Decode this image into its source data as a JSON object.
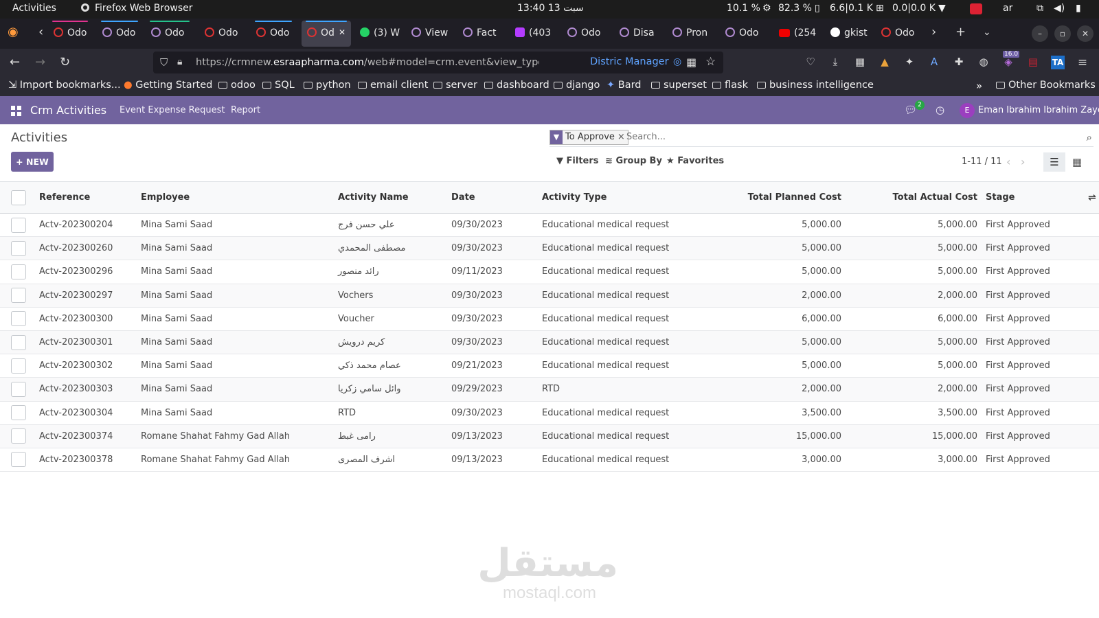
{
  "system_bar": {
    "activities": "Activities",
    "app": "Firefox Web Browser",
    "clock": "13:40  سبت 13",
    "cpu": "10.1 %",
    "mem": "82.3 %",
    "disk": "6.6|0.1 K",
    "net": "0.0|0.0 K",
    "lang": "ar"
  },
  "tabs": [
    {
      "label": "Odo",
      "icon": "odoo-red-icon",
      "accent": "#e0338f"
    },
    {
      "label": "Odo",
      "icon": "odoo-icon",
      "accent": "#3fa5ff"
    },
    {
      "label": "Odo",
      "icon": "odoo-icon",
      "accent": "#25c28b"
    },
    {
      "label": "Odo",
      "icon": "odoo-red-icon",
      "accent": ""
    },
    {
      "label": "Odo",
      "icon": "odoo-red-icon",
      "accent": "#3fa5ff"
    },
    {
      "label": "Od",
      "icon": "odoo-red-icon",
      "accent": "#3fa5ff"
    },
    {
      "label": "(3) W",
      "icon": "whatsapp-icon",
      "accent": ""
    },
    {
      "label": "View",
      "icon": "odoo-icon",
      "accent": ""
    },
    {
      "label": "Fact",
      "icon": "odoo-icon",
      "accent": ""
    },
    {
      "label": "(403",
      "icon": "mail-icon",
      "accent": ""
    },
    {
      "label": "Odo",
      "icon": "odoo-icon",
      "accent": ""
    },
    {
      "label": "Disa",
      "icon": "odoo-icon",
      "accent": ""
    },
    {
      "label": "Pron",
      "icon": "odoo-icon",
      "accent": ""
    },
    {
      "label": "Odo",
      "icon": "odoo-icon",
      "accent": ""
    },
    {
      "label": "(254",
      "icon": "youtube-icon",
      "accent": ""
    },
    {
      "label": "gkist",
      "icon": "github-icon",
      "accent": ""
    },
    {
      "label": "Odo",
      "icon": "odoo-red-icon",
      "accent": ""
    }
  ],
  "nav": {
    "url_prefix": "https://crmnew.",
    "url_domain": "esraapharma.com",
    "url_rest": "/web#model=crm.event&view_type=list&cids=",
    "url_tail_label": "Distric Manager",
    "ext_badge": "16.0"
  },
  "bookmarks": [
    "Import bookmarks...",
    "Getting Started",
    "odoo",
    "SQL",
    "python",
    "email client",
    "server",
    "dashboard",
    "django",
    "Bard",
    "superset",
    "flask",
    "business intelligence"
  ],
  "bookmarks_other": "Other Bookmarks",
  "odoo_nav": {
    "app_name": "Crm Activities",
    "menu": [
      "Event Expense Request",
      "Report"
    ],
    "chat_count": "2",
    "user_initial": "E",
    "user_name": "Eman Ibrahim Ibrahim Zayed",
    "accent": "#71639e"
  },
  "control": {
    "breadcrumb": "Activities",
    "new_label": "NEW",
    "facet_label": "To Approve",
    "search_placeholder": "Search...",
    "filters": "Filters",
    "group_by": "Group By",
    "favorites": "Favorites",
    "pager": "1-11 / 11"
  },
  "table": {
    "headers": {
      "reference": "Reference",
      "employee": "Employee",
      "activity_name": "Activity Name",
      "date": "Date",
      "activity_type": "Activity Type",
      "planned": "Total Planned Cost",
      "actual": "Total Actual Cost",
      "stage": "Stage"
    },
    "rows": [
      {
        "ref": "Actv-202300204",
        "emp": "Mina Sami Saad",
        "name": "علي حسن فرج",
        "date": "09/30/2023",
        "type": "Educational medical request",
        "planned": "5,000.00",
        "actual": "5,000.00",
        "stage": "First Approved"
      },
      {
        "ref": "Actv-202300260",
        "emp": "Mina Sami Saad",
        "name": "مصطفى المحمدي",
        "date": "09/30/2023",
        "type": "Educational medical request",
        "planned": "5,000.00",
        "actual": "5,000.00",
        "stage": "First Approved"
      },
      {
        "ref": "Actv-202300296",
        "emp": "Mina Sami Saad",
        "name": "رائد منصور",
        "date": "09/11/2023",
        "type": "Educational medical request",
        "planned": "5,000.00",
        "actual": "5,000.00",
        "stage": "First Approved"
      },
      {
        "ref": "Actv-202300297",
        "emp": "Mina Sami Saad",
        "name": "Vochers",
        "date": "09/30/2023",
        "type": "Educational medical request",
        "planned": "2,000.00",
        "actual": "2,000.00",
        "stage": "First Approved"
      },
      {
        "ref": "Actv-202300300",
        "emp": "Mina Sami Saad",
        "name": "Voucher",
        "date": "09/30/2023",
        "type": "Educational medical request",
        "planned": "6,000.00",
        "actual": "6,000.00",
        "stage": "First Approved"
      },
      {
        "ref": "Actv-202300301",
        "emp": "Mina Sami Saad",
        "name": "كريم درويش",
        "date": "09/30/2023",
        "type": "Educational medical request",
        "planned": "5,000.00",
        "actual": "5,000.00",
        "stage": "First Approved"
      },
      {
        "ref": "Actv-202300302",
        "emp": "Mina Sami Saad",
        "name": "عصام محمد ذكي",
        "date": "09/21/2023",
        "type": "Educational medical request",
        "planned": "5,000.00",
        "actual": "5,000.00",
        "stage": "First Approved"
      },
      {
        "ref": "Actv-202300303",
        "emp": "Mina Sami Saad",
        "name": "وائل سامي زكريا",
        "date": "09/29/2023",
        "type": "RTD",
        "planned": "2,000.00",
        "actual": "2,000.00",
        "stage": "First Approved"
      },
      {
        "ref": "Actv-202300304",
        "emp": "Mina Sami Saad",
        "name": "RTD",
        "date": "09/30/2023",
        "type": "Educational medical request",
        "planned": "3,500.00",
        "actual": "3,500.00",
        "stage": "First Approved"
      },
      {
        "ref": "Actv-202300374",
        "emp": "Romane Shahat Fahmy Gad Allah",
        "name": "رامى غبط",
        "date": "09/13/2023",
        "type": "Educational medical request",
        "planned": "15,000.00",
        "actual": "15,000.00",
        "stage": "First Approved"
      },
      {
        "ref": "Actv-202300378",
        "emp": "Romane Shahat Fahmy Gad Allah",
        "name": "اشرف المصرى",
        "date": "09/13/2023",
        "type": "Educational medical request",
        "planned": "3,000.00",
        "actual": "3,000.00",
        "stage": "First Approved"
      }
    ]
  },
  "watermark": {
    "arabic": "مستقل",
    "latin": "mostaql.com"
  }
}
